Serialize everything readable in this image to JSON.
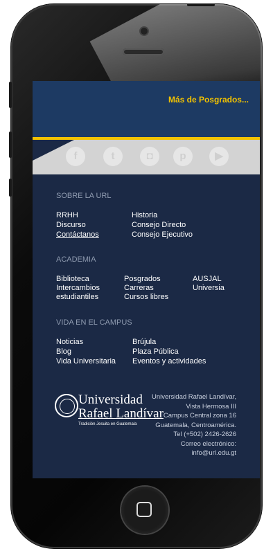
{
  "header": {
    "more_link": "Más de Posgrados..."
  },
  "social": [
    {
      "name": "facebook-icon",
      "glyph": "f"
    },
    {
      "name": "twitter-icon",
      "glyph": "t"
    },
    {
      "name": "instagram-icon",
      "glyph": "◘"
    },
    {
      "name": "pinterest-icon",
      "glyph": "p"
    },
    {
      "name": "youtube-icon",
      "glyph": "▶"
    }
  ],
  "sobre": {
    "title": "SOBRE LA URL",
    "col1": [
      "RRHH",
      "Discurso",
      "Contáctanos"
    ],
    "col2": [
      "Historia",
      "Consejo Directo",
      "Consejo Ejecutivo"
    ]
  },
  "academia": {
    "title": "ACADEMIA",
    "col1": [
      "Biblioteca",
      "Intercambios",
      "estudiantiles"
    ],
    "col2": [
      "Posgrados",
      "Carreras",
      "Cursos libres"
    ],
    "col3": [
      "AUSJAL",
      "Universia"
    ]
  },
  "campus": {
    "title": "VIDA EN EL CAMPUS",
    "col1": [
      "Noticias",
      "Blog",
      "Vida Universitaria"
    ],
    "col2": [
      "Brújula",
      "Plaza Pública",
      "Eventos y actividades"
    ]
  },
  "logo": {
    "line1": "Universidad",
    "line2": "Rafael Landívar",
    "tagline": "Tradición Jesuita en Guatemala"
  },
  "address": [
    "Universidad Rafael Landívar,",
    "Vista Hermosa III",
    "Campus Central zona 16",
    "Guatemala, Centroamérica.",
    "Tel (+502) 2426-2626",
    "Correo electrónico:",
    "info@url.edu.gt"
  ]
}
